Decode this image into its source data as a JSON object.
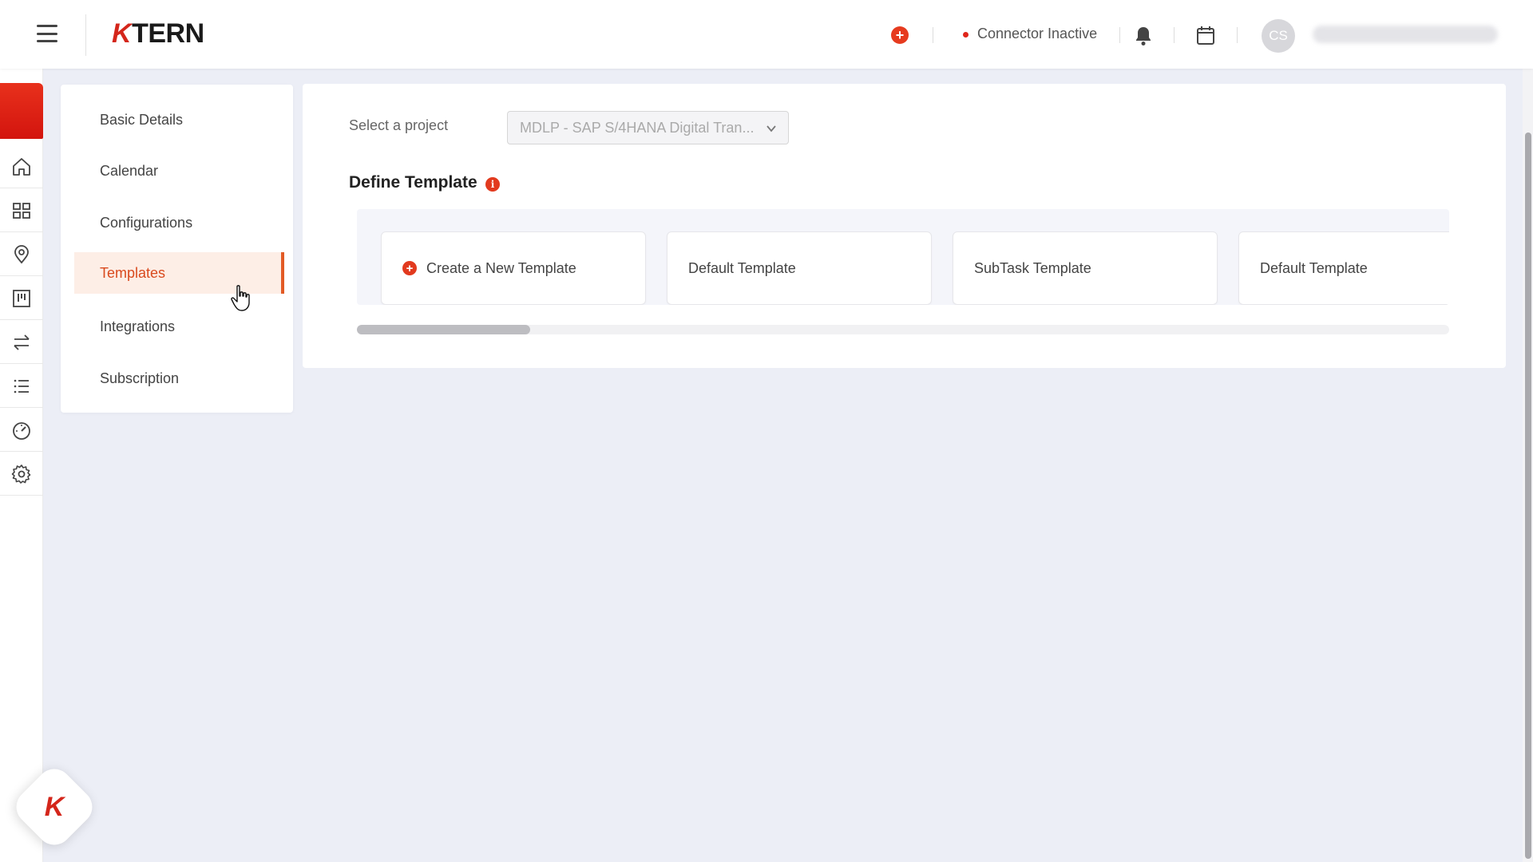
{
  "header": {
    "logo_k": "K",
    "logo_rest": "TERN",
    "add_symbol": "+",
    "connector_status": "Connector Inactive",
    "avatar_initials": "CS"
  },
  "rail": {
    "icons": [
      "home-icon",
      "dashboard-grid-icon",
      "location-pin-icon",
      "board-icon",
      "transfer-arrows-icon",
      "list-icon",
      "speedometer-icon",
      "gear-icon"
    ]
  },
  "settings_menu": {
    "items": [
      {
        "label": "Basic Details"
      },
      {
        "label": "Calendar"
      },
      {
        "label": "Configurations"
      },
      {
        "label": "Templates"
      },
      {
        "label": "Integrations"
      },
      {
        "label": "Subscription"
      }
    ],
    "active": "Templates"
  },
  "main": {
    "project_label": "Select a project",
    "project_value": "MDLP - SAP S/4HANA Digital Tran...",
    "section_title": "Define Template",
    "info_symbol": "i",
    "templates": [
      {
        "label": "Create a New Template",
        "plus": "+"
      },
      {
        "label": "Default Template"
      },
      {
        "label": "SubTask Template"
      },
      {
        "label": "Default Template"
      }
    ]
  },
  "fab": {
    "logo": "K"
  },
  "colors": {
    "accent": "#e23a1e",
    "active_bg": "#fdeee6",
    "page_bg": "#eceef6"
  }
}
